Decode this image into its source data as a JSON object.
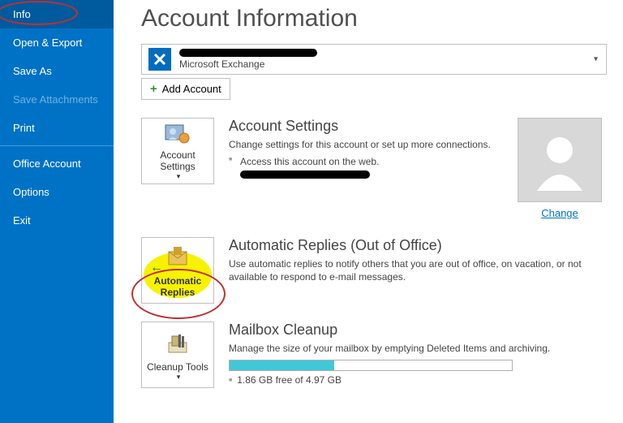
{
  "sidebar": {
    "items": [
      {
        "label": "Info",
        "selected": true
      },
      {
        "label": "Open & Export"
      },
      {
        "label": "Save As"
      },
      {
        "label": "Save Attachments",
        "disabled": true
      },
      {
        "label": "Print"
      },
      {
        "label": "Office Account"
      },
      {
        "label": "Options"
      },
      {
        "label": "Exit"
      }
    ]
  },
  "page_title": "Account Information",
  "account_box": {
    "subtitle": "Microsoft Exchange"
  },
  "add_account_label": "Add Account",
  "account_settings": {
    "button_label": "Account Settings",
    "title": "Account Settings",
    "desc": "Change settings for this account or set up more connections.",
    "bullet": "Access this account on the web."
  },
  "avatar": {
    "change_label": "Change"
  },
  "auto_replies": {
    "button_label": "Automatic Replies",
    "title": "Automatic Replies (Out of Office)",
    "desc": "Use automatic replies to notify others that you are out of office, on vacation, or not available to respond to e-mail messages."
  },
  "cleanup": {
    "button_label": "Cleanup Tools",
    "title": "Mailbox Cleanup",
    "desc": "Manage the size of your mailbox by emptying Deleted Items and archiving.",
    "storage_text": "1.86 GB free of 4.97 GB",
    "used_percent": 37
  }
}
